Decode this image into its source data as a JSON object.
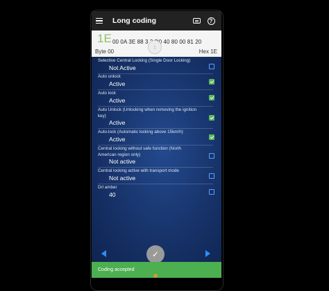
{
  "appbar": {
    "title": "Long coding",
    "menu_icon": "hamburger-menu-icon",
    "keyboard_icon": "keyboard-icon",
    "help_icon": "help-icon",
    "help_glyph": "?"
  },
  "hex_panel": {
    "big_byte": "1E",
    "bytes": "00 0A 3E 88 3 3 D0 40 80 00 81 20",
    "byte_label": "Byte 00",
    "hex_label": "Hex 1E",
    "center_glyph": "↕"
  },
  "options": [
    {
      "label": "Selective Central Locking (Single Door Locking)",
      "value": "Not Active",
      "checked": false
    },
    {
      "label": "Auto unlock",
      "value": "Active",
      "checked": true
    },
    {
      "label": "Auto lock",
      "value": "Active",
      "checked": true
    },
    {
      "label": "Auto Unlock (Unlocking when removing the ignition key)",
      "value": "Active",
      "checked": true
    },
    {
      "label": "Auto-lock (Automatic locking above 15km/h)",
      "value": "Active",
      "checked": true
    },
    {
      "label": "Central locking without safe function (North American region only)",
      "value": "Not active",
      "checked": false
    },
    {
      "label": "Central locking active with transport mode",
      "value": "Not active",
      "checked": false
    },
    {
      "label": "Drl amber",
      "value": "40",
      "checked": false
    }
  ],
  "bottom": {
    "fab_glyph": "✓",
    "snackbar_text": "Coding accepted"
  },
  "colors": {
    "accent_blue": "#2f8dff",
    "check_green": "#5cb85c",
    "snackbar_green": "#4caf50",
    "background_blue": "#17336a"
  }
}
